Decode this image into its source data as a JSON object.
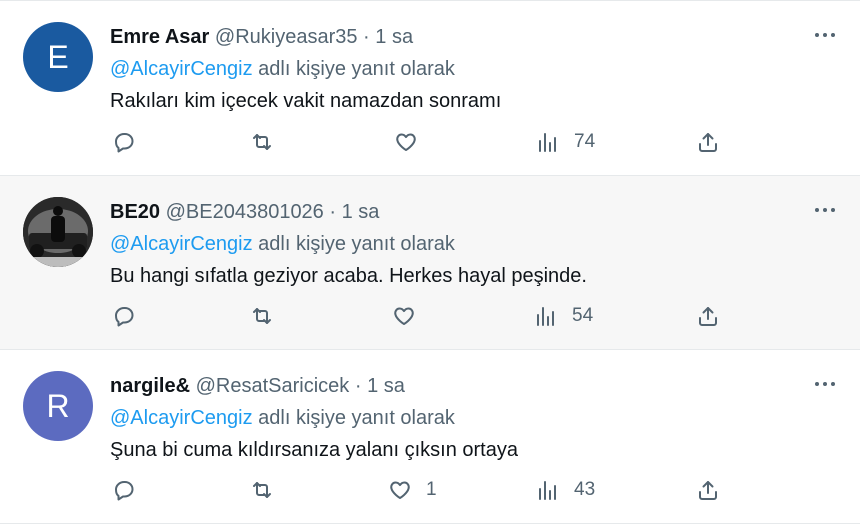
{
  "tweets": [
    {
      "name": "Emre Asar",
      "handle": "@Rukiyeasar35",
      "separator": "·",
      "time": "1 sa",
      "reply_mention": "@AlcayirCengiz",
      "reply_suffix": "adlı kişiye yanıt olarak",
      "text": "Rakıları kim içecek vakit namazdan sonramı",
      "avatar_letter": "E",
      "avatar_color": "#1a5aa0",
      "likes": "",
      "views": "74"
    },
    {
      "name": "BE20",
      "handle": "@BE2043801026",
      "separator": "·",
      "time": "1 sa",
      "reply_mention": "@AlcayirCengiz",
      "reply_suffix": "adlı kişiye yanıt olarak",
      "text": "Bu hangi sıfatla geziyor acaba. Herkes hayal peşinde.",
      "avatar_letter": "",
      "avatar_color": "#1b1b1b",
      "likes": "",
      "views": "54"
    },
    {
      "name": "nargile&",
      "handle": "@ResatSaricicek",
      "separator": "·",
      "time": "1 sa",
      "reply_mention": "@AlcayirCengiz",
      "reply_suffix": "adlı kişiye yanıt olarak",
      "text": "Şuna bi cuma kıldırsanıza yalanı çıksın ortaya",
      "avatar_letter": "R",
      "avatar_color": "#5c6bc0",
      "likes": "1",
      "views": "43"
    }
  ],
  "icons": {
    "reply": "reply-icon",
    "retweet": "retweet-icon",
    "like": "heart-icon",
    "views": "views-icon",
    "share": "share-icon",
    "more": "more-icon"
  }
}
